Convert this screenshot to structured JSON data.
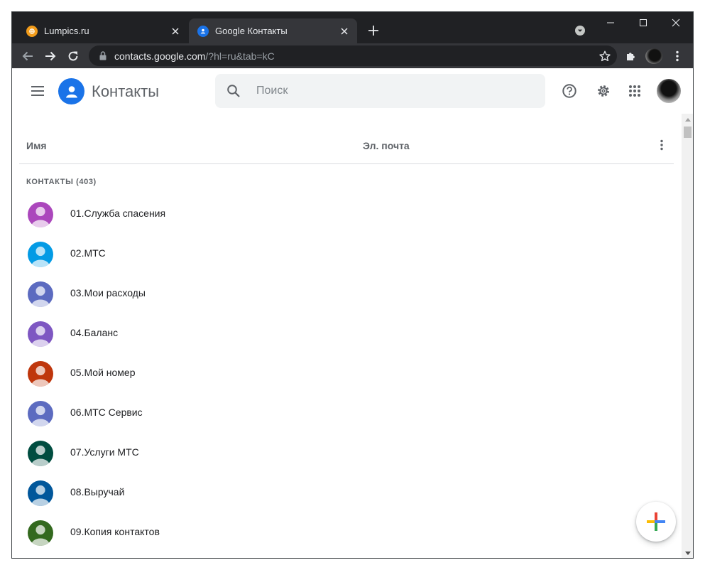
{
  "browser": {
    "tabs": [
      {
        "title": "Lumpics.ru",
        "active": false,
        "favicon": "lumpics-favicon"
      },
      {
        "title": "Google Контакты",
        "active": true,
        "favicon": "google-contacts-favicon"
      }
    ],
    "url_host": "contacts.google.com",
    "url_rest": "/?hl=ru&tab=kC",
    "frame_color": "#202124",
    "toolbar_color": "#35363a"
  },
  "app": {
    "title": "Контакты",
    "search_placeholder": "Поиск",
    "brand_color": "#1a73e8",
    "icons": [
      "menu-icon",
      "help-icon",
      "settings-icon",
      "apps-grid-icon",
      "account-avatar"
    ]
  },
  "list": {
    "columns": {
      "name": "Имя",
      "email": "Эл. почта"
    },
    "section_label": "КОНТАКТЫ (403)",
    "contacts": [
      {
        "name": "01.Служба спасения",
        "color": "#ab47bc"
      },
      {
        "name": "02.МТС",
        "color": "#039be5"
      },
      {
        "name": "03.Мои расходы",
        "color": "#5c6bc0"
      },
      {
        "name": "04.Баланс",
        "color": "#7e57c2"
      },
      {
        "name": "05.Мой номер",
        "color": "#bf360c"
      },
      {
        "name": "06.МТС Сервис",
        "color": "#5c6bc0"
      },
      {
        "name": "07.Услуги МТС",
        "color": "#004d40"
      },
      {
        "name": "08.Выручай",
        "color": "#01579b"
      },
      {
        "name": "09.Копия контактов",
        "color": "#33691e"
      }
    ]
  },
  "fab": {
    "icon": "add-contact-plus-icon",
    "colors": [
      "#4285f4",
      "#ea4335",
      "#fbbc04",
      "#34a853"
    ]
  }
}
